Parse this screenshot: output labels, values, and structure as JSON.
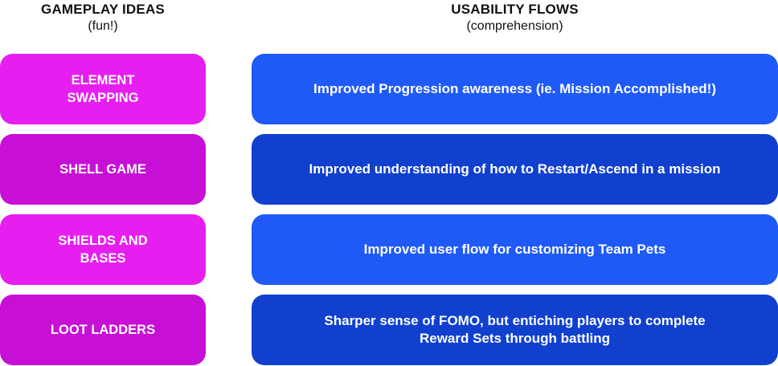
{
  "columns": {
    "left": {
      "title": "GAMEPLAY IDEAS",
      "subtitle": "(fun!)"
    },
    "right": {
      "title": "USABILITY FLOWS",
      "subtitle": "(comprehension)"
    }
  },
  "gameplay_ideas": [
    {
      "label": "ELEMENT SWAPPING",
      "color": "#e61ff0"
    },
    {
      "label": "SHELL GAME",
      "color": "#c70fd6"
    },
    {
      "label": "SHIELDS AND BASES",
      "color": "#e61ff0"
    },
    {
      "label": "LOOT LADDERS",
      "color": "#c70fd6"
    }
  ],
  "usability_flows": [
    {
      "label": "Improved Progression awareness (ie. Mission Accomplished!)",
      "color": "#1f5af7"
    },
    {
      "label": "Improved understanding of how to Restart/Ascend in a mission",
      "color": "#1140cf"
    },
    {
      "label": "Improved user flow for customizing Team Pets",
      "color": "#1f5af7"
    },
    {
      "label": "Sharper sense of FOMO, but entiching players to complete Reward Sets through battling",
      "color": "#1140cf"
    }
  ]
}
